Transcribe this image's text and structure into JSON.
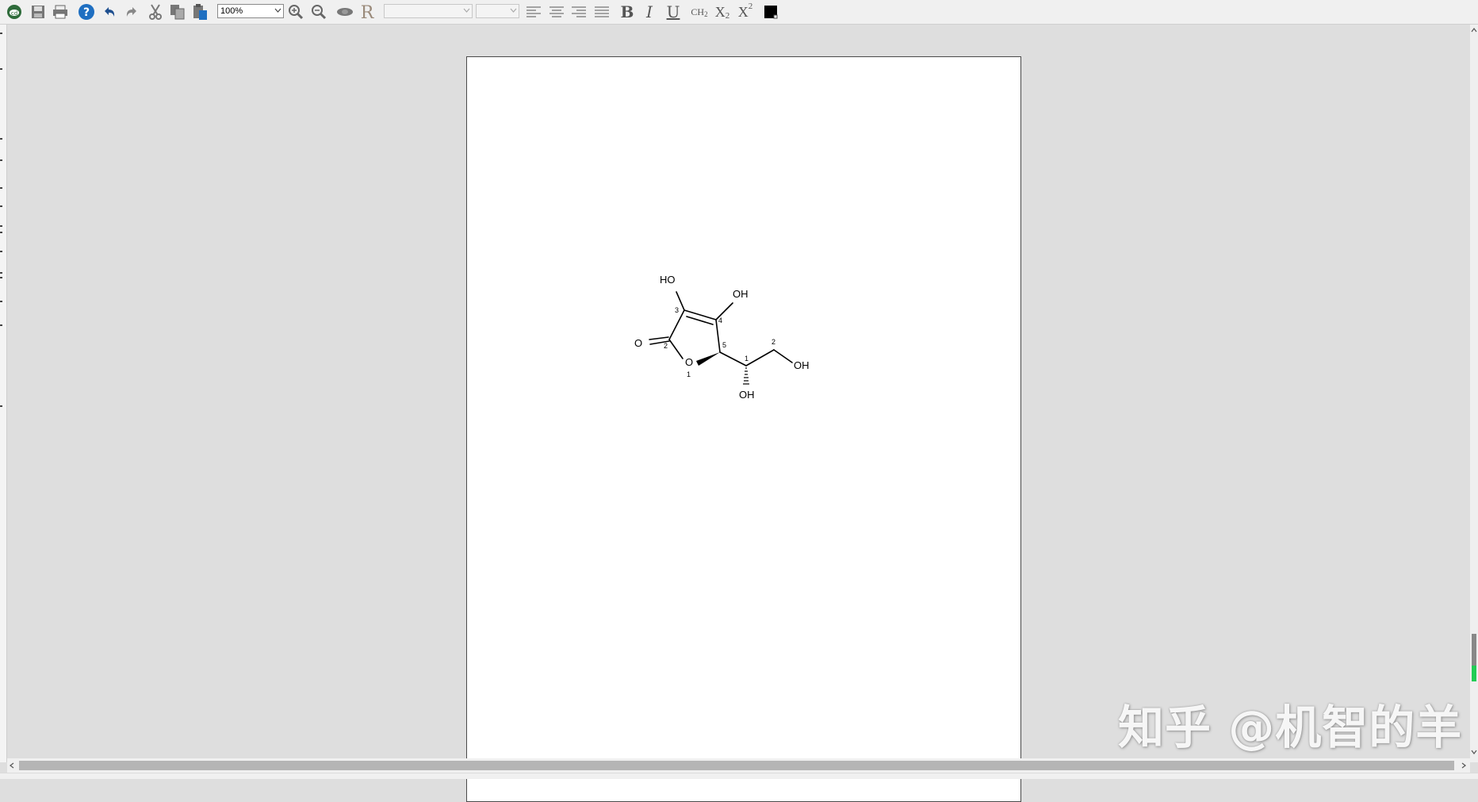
{
  "toolbar": {
    "zoom": {
      "value": "100%"
    },
    "font_select": {
      "value": ""
    },
    "size_select": {
      "value": ""
    },
    "format": {
      "bold": "B",
      "italic": "I",
      "underline": "U",
      "ch2": "CH",
      "ch2_sub": "2",
      "subscript": "X",
      "subscript_sub": "2",
      "superscript": "X",
      "superscript_sup": "2"
    },
    "color_swatch": "#000000",
    "icons": [
      "app-logo-icon",
      "save-icon",
      "print-icon",
      "help-icon",
      "undo-icon",
      "redo-icon",
      "cut-icon",
      "copy-icon",
      "paste-icon",
      "zoom-in-icon",
      "zoom-out-icon",
      "view-icon",
      "r-icon"
    ]
  },
  "molecule": {
    "atoms": {
      "o_carbonyl": "O",
      "o_ring": "O",
      "oh_3": "HO",
      "oh_4": "OH",
      "oh_side1": "OH",
      "oh_side2": "OH"
    },
    "locants": {
      "n1": "1",
      "n2": "2",
      "n3": "3",
      "n4": "4",
      "n5": "5",
      "s1": "1",
      "s2": "2"
    }
  },
  "watermark": "知乎 @机智的羊",
  "colors": {
    "workspace": "#dedede",
    "page": "#ffffff",
    "scroll_thumb": "#b5b5b5",
    "accent_green": "#22cc55"
  }
}
